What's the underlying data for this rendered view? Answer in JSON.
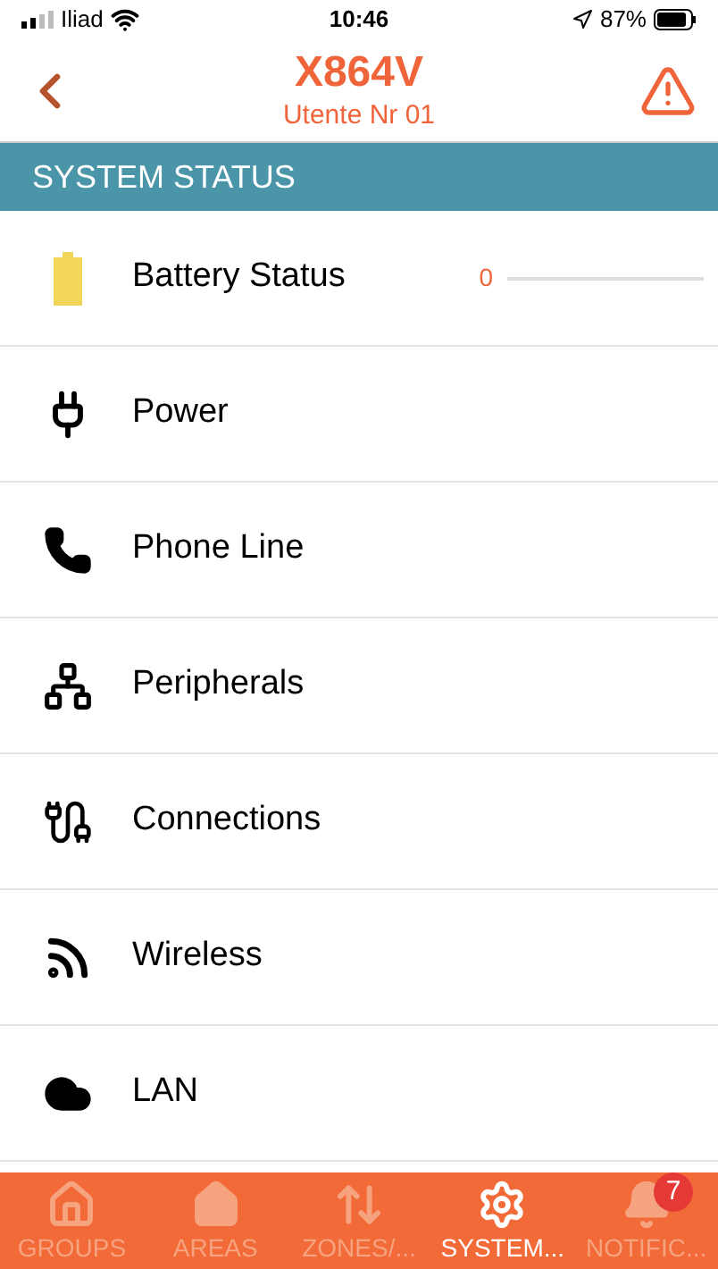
{
  "status_bar": {
    "carrier": "Iliad",
    "time": "10:46",
    "battery": "87%"
  },
  "header": {
    "title": "X864V",
    "subtitle": "Utente Nr 01"
  },
  "section": {
    "title": "SYSTEM STATUS"
  },
  "rows": [
    {
      "label": "Battery Status",
      "reading": "0"
    },
    {
      "label": "Power"
    },
    {
      "label": "Phone Line"
    },
    {
      "label": "Peripherals"
    },
    {
      "label": "Connections"
    },
    {
      "label": "Wireless"
    },
    {
      "label": "LAN"
    }
  ],
  "tabs": [
    {
      "label": "GROUPS",
      "selected": false
    },
    {
      "label": "AREAS",
      "selected": false
    },
    {
      "label": "ZONES/...",
      "selected": false
    },
    {
      "label": "SYSTEM...",
      "selected": true
    },
    {
      "label": "NOTIFIC...",
      "selected": false,
      "badge": "7"
    }
  ]
}
